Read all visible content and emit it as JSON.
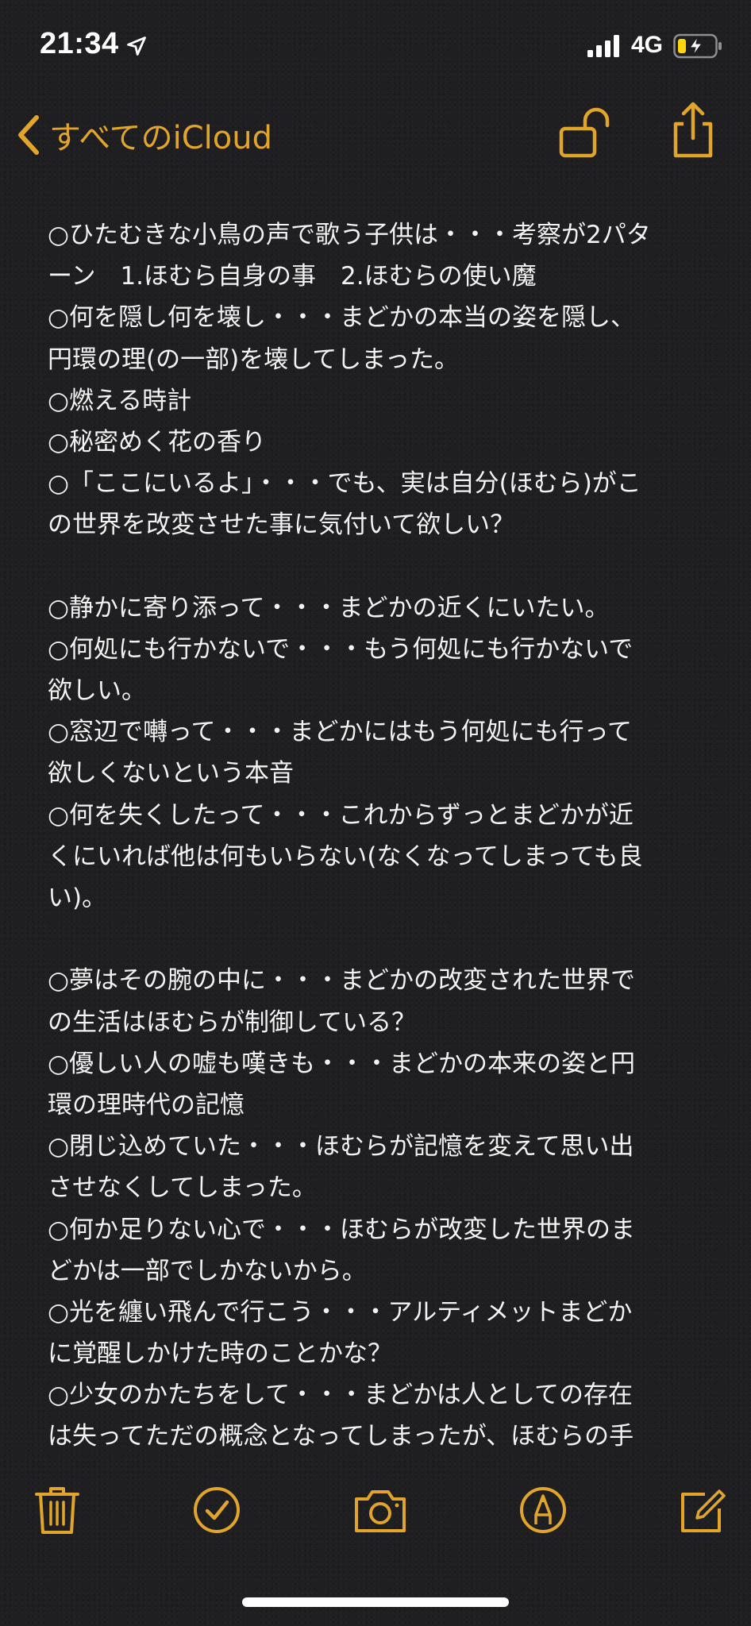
{
  "status_bar": {
    "time": "21:34",
    "network": "4G"
  },
  "nav": {
    "back_label": "すべてのiCloud"
  },
  "accent_color": "#e0a52a",
  "note_lines": [
    "○ひたむきな小鳥の声で歌う子供は・・・考察が2パタ",
    "ーン　1.ほむら自身の事　2.ほむらの使い魔",
    "○何を隠し何を壊し・・・まどかの本当の姿を隠し、",
    "円環の理(の一部)を壊してしまった。",
    "○燃える時計",
    "○秘密めく花の香り",
    "○「ここにいるよ」・・・でも、実は自分(ほむら)がこ",
    "の世界を改変させた事に気付いて欲しい？",
    "",
    "○静かに寄り添って・・・まどかの近くにいたい。",
    "○何処にも行かないで・・・もう何処にも行かないで",
    "欲しい。",
    "○窓辺で囀って・・・まどかにはもう何処にも行って",
    "欲しくないという本音",
    "○何を失くしたって・・・これからずっとまどかが近",
    "くにいれば他は何もいらない(なくなってしまっても良",
    "い)。",
    "",
    "○夢はその腕の中に・・・まどかの改変された世界で",
    "の生活はほむらが制御している？",
    "○優しい人の嘘も嘆きも・・・まどかの本来の姿と円",
    "環の理時代の記憶",
    "○閉じ込めていた・・・ほむらが記憶を変えて思い出",
    "させなくしてしまった。",
    "○何か足りない心で・・・ほむらが改変した世界のま",
    "どかは一部でしかないから。",
    "○光を纏い飛んで行こう・・・アルティメットまどか",
    "に覚醒しかけた時のことかな？",
    "○少女のかたちをして・・・まどかは人としての存在",
    "は失ってただの概念となってしまったが、ほむらの手"
  ],
  "toolbar": {
    "icons": [
      "trash-icon",
      "checklist-icon",
      "camera-icon",
      "markup-icon",
      "compose-icon"
    ]
  }
}
